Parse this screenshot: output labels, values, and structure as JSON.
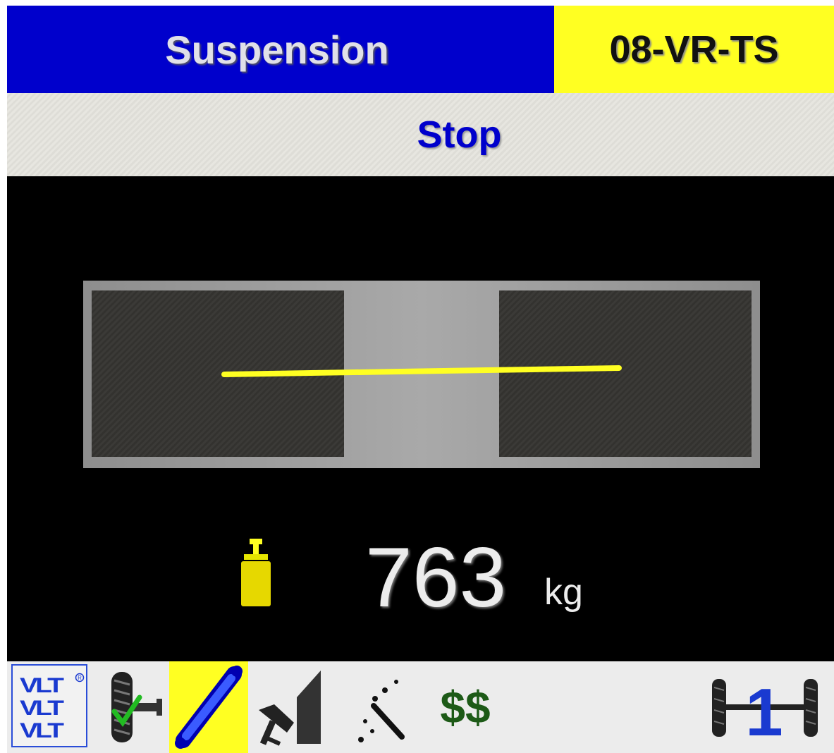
{
  "header": {
    "title": "Suspension",
    "plate": "08-VR-TS"
  },
  "status": {
    "text": "Stop"
  },
  "measurement": {
    "weight_value": "763",
    "weight_unit": "kg",
    "icon": "weight-icon"
  },
  "toolbar": {
    "items": [
      {
        "icon": "vlt-logo-icon",
        "label": "VLT"
      },
      {
        "icon": "tyre-check-icon"
      },
      {
        "icon": "shock-absorber-icon",
        "active": true
      },
      {
        "icon": "brake-test-icon"
      },
      {
        "icon": "spray-dots-icon"
      },
      {
        "icon": "cost-icon",
        "label": "$$"
      },
      {
        "icon": "axle-icon",
        "label": "1"
      }
    ]
  },
  "colors": {
    "title_bg": "#0000cc",
    "plate_bg": "#ffff22",
    "status_text": "#0000cc",
    "balance_line": "#ffff22",
    "screen_bg": "#000000",
    "toolbar_bg": "#ececec"
  }
}
